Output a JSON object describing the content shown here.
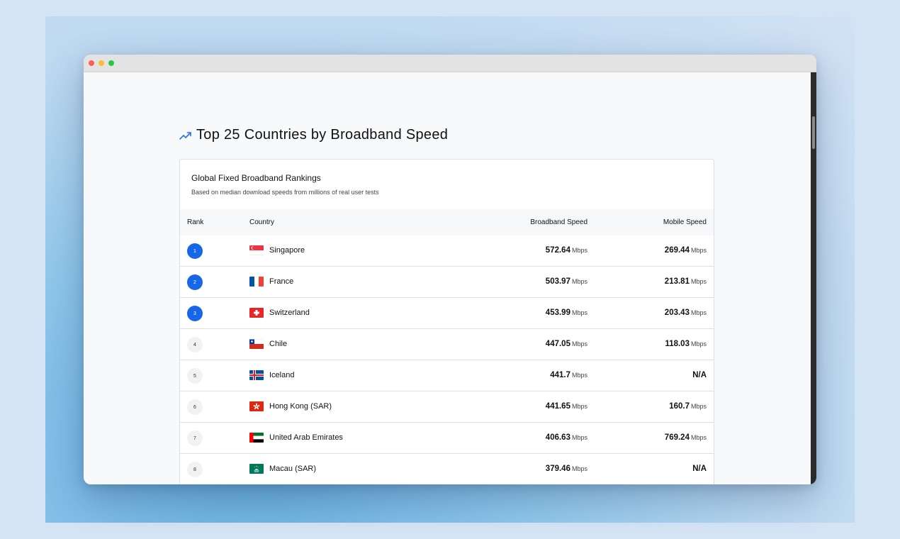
{
  "page": {
    "title": "Top 25 Countries by Broadband Speed"
  },
  "card": {
    "title": "Global Fixed Broadband Rankings",
    "subtitle": "Based on median download speeds from millions of real user tests"
  },
  "table": {
    "headers": {
      "rank": "Rank",
      "country": "Country",
      "broadband": "Broadband Speed",
      "mobile": "Mobile Speed"
    },
    "unit": "Mbps",
    "rows": [
      {
        "rank": "1",
        "country": "Singapore",
        "flag": "flag-singapore",
        "broadband": "572.64",
        "mobile": "269.44"
      },
      {
        "rank": "2",
        "country": "France",
        "flag": "flag-france",
        "broadband": "503.97",
        "mobile": "213.81"
      },
      {
        "rank": "3",
        "country": "Switzerland",
        "flag": "flag-switzerland",
        "broadband": "453.99",
        "mobile": "203.43"
      },
      {
        "rank": "4",
        "country": "Chile",
        "flag": "flag-chile",
        "broadband": "447.05",
        "mobile": "118.03"
      },
      {
        "rank": "5",
        "country": "Iceland",
        "flag": "flag-iceland",
        "broadband": "441.7",
        "mobile": "N/A"
      },
      {
        "rank": "6",
        "country": "Hong Kong (SAR)",
        "flag": "flag-hong-kong",
        "broadband": "441.65",
        "mobile": "160.7"
      },
      {
        "rank": "7",
        "country": "United Arab Emirates",
        "flag": "flag-uae",
        "broadband": "406.63",
        "mobile": "769.24"
      },
      {
        "rank": "8",
        "country": "Macau (SAR)",
        "flag": "flag-macau",
        "broadband": "379.46",
        "mobile": "N/A"
      }
    ]
  },
  "colors": {
    "accent": "#1766e8",
    "trend_icon": "#2f6fe0"
  },
  "icons": {
    "heading": "trending-up-icon"
  }
}
